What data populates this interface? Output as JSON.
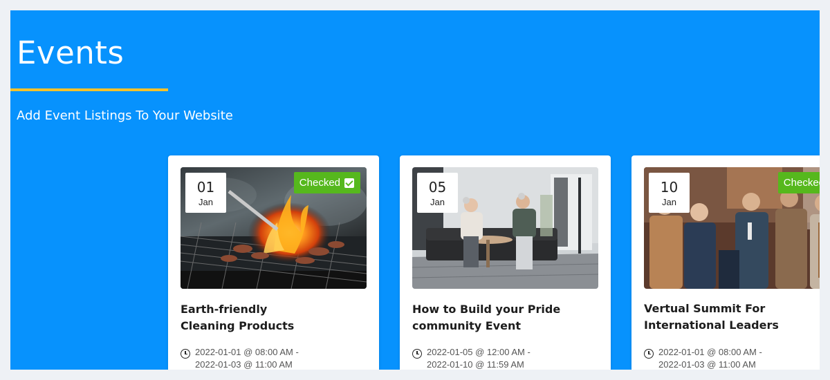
{
  "header": {
    "title": "Events",
    "subtitle": "Add Event Listings To Your Website"
  },
  "colors": {
    "panel_background": "#0792fd",
    "underline_accent": "#f4c22b",
    "checked_badge": "#56b81d"
  },
  "events": [
    {
      "day": "01",
      "month": "Jan",
      "badge": "Checked",
      "title": "Earth-friendly Cleaning Products",
      "start": "2022-01-01 @ 08:00 AM -",
      "end": "2022-01-03 @ 11:00 AM",
      "image": "barbecue-grill-photo"
    },
    {
      "day": "05",
      "month": "Jan",
      "title": "How to Build your Pride community Event",
      "start": "2022-01-05 @ 12:00 AM -",
      "end": "2022-01-10 @ 11:59 AM",
      "image": "seniors-living-room-photo"
    },
    {
      "day": "10",
      "month": "Jan",
      "badge": "Checked",
      "title": "Vertual Summit For International Leaders",
      "start": "2022-01-01 @ 08:00 AM -",
      "end": "2022-01-03 @ 11:00 AM",
      "image": "business-networking-photo"
    }
  ]
}
